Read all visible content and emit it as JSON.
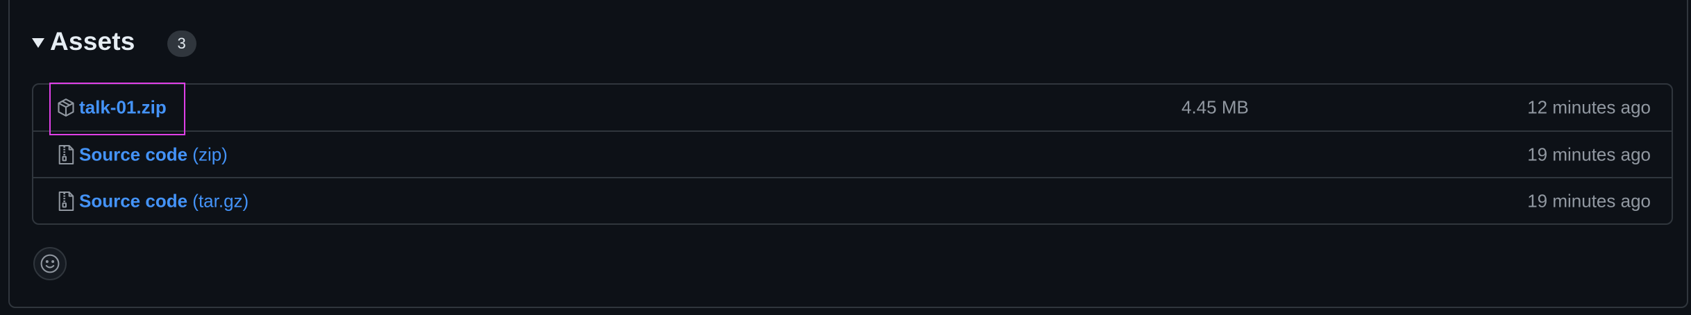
{
  "assets": {
    "title": "Assets",
    "count": "3",
    "items": [
      {
        "icon": "package-icon",
        "name": "talk-01.zip",
        "suffix": "",
        "size": "4.45 MB",
        "time": "12 minutes ago"
      },
      {
        "icon": "file-zip-icon",
        "name": "Source code",
        "suffix": " (zip)",
        "size": "",
        "time": "19 minutes ago"
      },
      {
        "icon": "file-zip-icon",
        "name": "Source code",
        "suffix": " (tar.gz)",
        "size": "",
        "time": "19 minutes ago"
      }
    ]
  },
  "colors": {
    "background": "#0d1117",
    "border": "#30363d",
    "link": "#4493f8",
    "muted": "#9198a1",
    "highlight": "#e040e8"
  }
}
